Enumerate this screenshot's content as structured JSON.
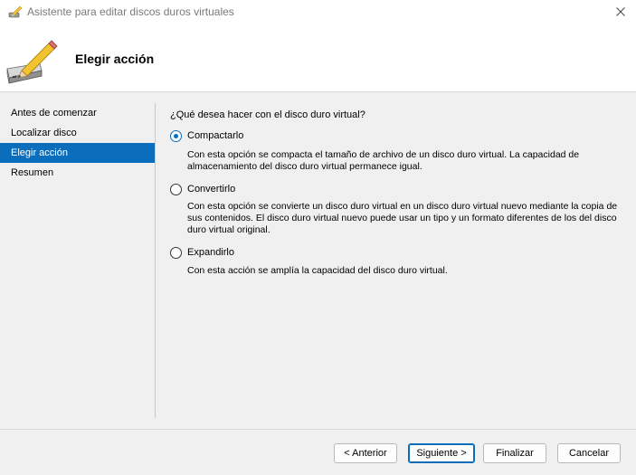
{
  "window": {
    "title": "Asistente para editar discos duros virtuales",
    "close_glyph": "✕"
  },
  "header": {
    "title": "Elegir acción",
    "icon": "disk-pencil-icon"
  },
  "nav": {
    "items": [
      {
        "label": "Antes de comenzar"
      },
      {
        "label": "Localizar disco"
      },
      {
        "label": "Elegir acción"
      },
      {
        "label": "Resumen"
      }
    ]
  },
  "content": {
    "question": "¿Qué desea hacer con el disco duro virtual?",
    "options": [
      {
        "label": "Compactarlo",
        "checked": true,
        "description": "Con esta opción se compacta el tamaño de archivo de un disco duro virtual. La capacidad de almacenamiento del disco duro virtual permanece igual."
      },
      {
        "label": "Convertirlo",
        "checked": false,
        "description": "Con esta opción se convierte un disco duro virtual en un disco duro virtual nuevo mediante la copia de sus contenidos. El disco duro virtual nuevo puede usar un tipo y un formato diferentes de los del disco duro virtual original."
      },
      {
        "label": "Expandirlo",
        "checked": false,
        "description": "Con esta acción se amplía la capacidad del disco duro virtual."
      }
    ]
  },
  "buttons": {
    "previous": "< Anterior",
    "next": "Siguiente >",
    "finish": "Finalizar",
    "cancel": "Cancelar"
  },
  "colors": {
    "accent": "#0a6ebd",
    "background": "#f0f0f0",
    "header_bg": "#ffffff"
  }
}
